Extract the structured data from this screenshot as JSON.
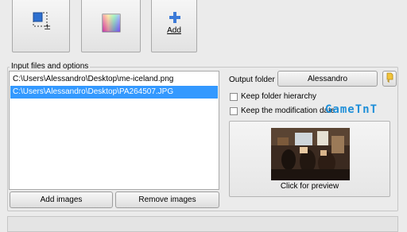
{
  "toolbar": {
    "buttons": [
      {
        "name": "resize-tool-button",
        "label": "",
        "icon": "resize-icon"
      },
      {
        "name": "color-tool-button",
        "label": "",
        "icon": "color-gradient-icon"
      },
      {
        "name": "add-button",
        "label": "Add",
        "icon": "plus-icon"
      }
    ]
  },
  "input_group": {
    "title": "Input files and options",
    "files": [
      {
        "path": "C:\\Users\\Alessandro\\Desktop\\me-iceland.png",
        "selected": false
      },
      {
        "path": "C:\\Users\\Alessandro\\Desktop\\PA264507.JPG",
        "selected": true
      }
    ],
    "add_images_label": "Add images",
    "remove_images_label": "Remove images"
  },
  "options": {
    "output_folder_label": "Output folder",
    "output_folder_value": "Alessandro",
    "keep_folder_hierarchy_label": "Keep folder hierarchy",
    "keep_folder_hierarchy_checked": false,
    "keep_modification_date_label": "Keep the modification date",
    "keep_modification_date_checked": false,
    "preview_caption": "Click for preview",
    "folder_icon": "folder-icon"
  },
  "watermark": "GameTnT",
  "colors": {
    "selection": "#3399ff",
    "window_bg": "#ebebeb",
    "watermark": "#1f8fd8"
  }
}
